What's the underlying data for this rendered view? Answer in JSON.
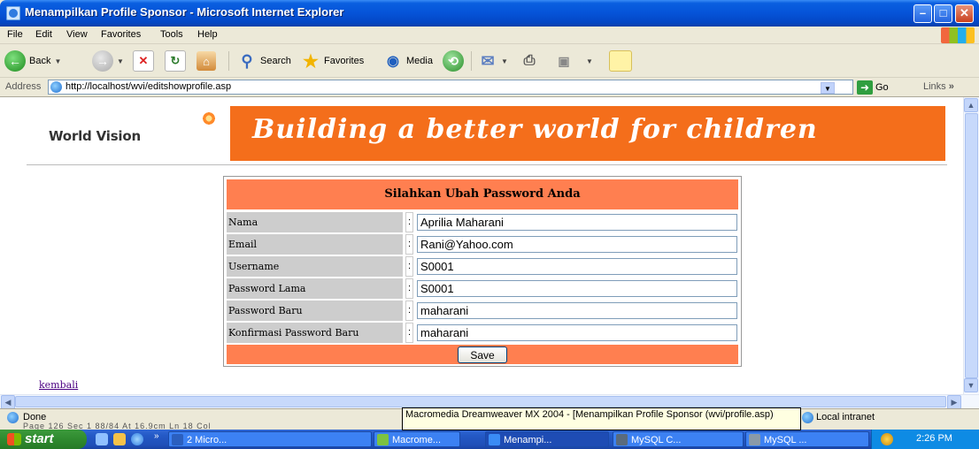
{
  "window": {
    "title": "Menampilkan Profile Sponsor - Microsoft Internet Explorer",
    "controls": {
      "minimize": "–",
      "maximize": "□",
      "close": "✕"
    }
  },
  "menu": [
    "File",
    "Edit",
    "View",
    "Favorites",
    "Tools",
    "Help"
  ],
  "toolbar": {
    "back_label": "Back",
    "search_label": "Search",
    "favorites_label": "Favorites",
    "media_label": "Media"
  },
  "address": {
    "label": "Address",
    "url": "http://localhost/wvi/editshowprofile.asp",
    "go_label": "Go",
    "links_label": "Links",
    "links_chevron": "»"
  },
  "page": {
    "logo_text": "World Vision",
    "banner_text": "Building a better world for children",
    "form": {
      "heading": "Silahkan Ubah Password Anda",
      "colon": ":",
      "rows": [
        {
          "label": "Nama",
          "value": "Aprilia Maharani"
        },
        {
          "label": "Email",
          "value": "Rani@Yahoo.com"
        },
        {
          "label": "Username",
          "value": "S0001"
        },
        {
          "label": "Password Lama",
          "value": "S0001"
        },
        {
          "label": "Password Baru",
          "value": "maharani"
        },
        {
          "label": "Konfirmasi Password Baru",
          "value": "maharani"
        }
      ],
      "save_label": "Save"
    },
    "back_link": "kembali"
  },
  "status": {
    "text": "Done",
    "background_text": "Page 126    Sec 1    88/84    At 16.9cm   Ln 18   Col",
    "zone": "Local intranet",
    "tooltip": "Macromedia Dreamweaver MX 2004 - [Menampilkan Profile Sponsor (wvi/profile.asp)"
  },
  "taskbar": {
    "start_label": "start",
    "quicklaunch_chevron": "»",
    "tasks": [
      {
        "label": "2 Micro...",
        "icon_color": "#2b5fbf"
      },
      {
        "label": "Macrome...",
        "icon_color": "#7cc242"
      },
      {
        "label": "Menampi...",
        "icon_color": "#3a8cf5"
      },
      {
        "label": "MySQL C...",
        "icon_color": "#5a6b7d"
      },
      {
        "label": "MySQL ...",
        "icon_color": "#8a9aa8"
      }
    ],
    "clock": "2:26 PM"
  },
  "colors": {
    "banner_orange": "#f46e1b",
    "form_header": "#ff7f50",
    "label_cell": "#cdcdcd",
    "link": "#4b0082"
  }
}
